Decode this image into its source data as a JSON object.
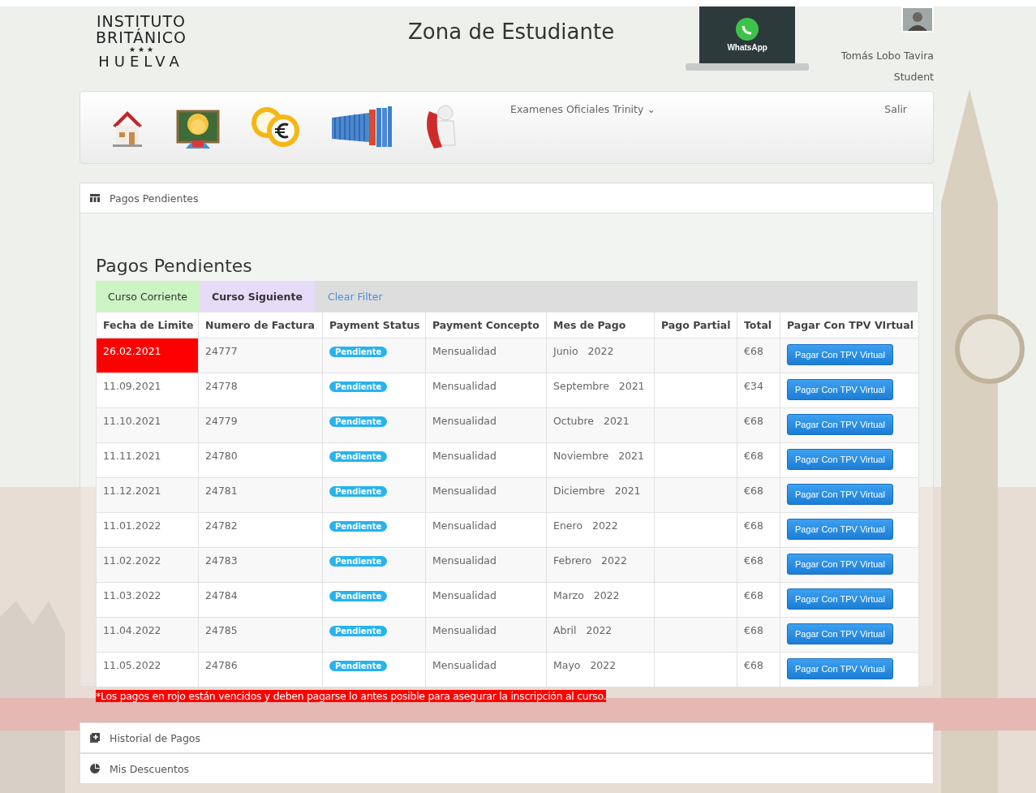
{
  "header": {
    "logo": {
      "line1": "INSTITUTO",
      "line2": "BRITÁNICO",
      "stars": "★ ★ ★",
      "line3": "HUELVA"
    },
    "title": "Zona de Estudiante",
    "promo_label": "WhatsApp",
    "user": {
      "name": "Tomás Lobo Tavira",
      "role": "Student"
    }
  },
  "nav": {
    "menu": "Examenes Oficiales Trinity",
    "menu_caret": "⌄",
    "logout": "Salir"
  },
  "panel": {
    "heading": "Pagos Pendientes",
    "title": "Pagos Pendientes",
    "tabs": [
      {
        "label": "Curso Corriente",
        "kind": "filter",
        "color": "#ccf5c4",
        "selected": false
      },
      {
        "label": "Curso Siguiente",
        "kind": "filter",
        "color": "#e6dcf7",
        "selected": true
      },
      {
        "label": "Clear Filter",
        "kind": "link",
        "selected": false
      }
    ],
    "table": {
      "columns": [
        "Fecha de Limite",
        "Numero de Factura",
        "Payment Status",
        "Payment Concepto",
        "Mes de Pago",
        "Pago Partial",
        "Total",
        "Pagar Con TPV VIrtual"
      ],
      "rows": [
        {
          "date": "26.02.2021",
          "overdue": true,
          "invoice": "24777",
          "status": "Pendiente",
          "concept": "Mensualidad",
          "month": "Junio   2022",
          "total": "€68",
          "action": "Pagar Con TPV Virtual"
        },
        {
          "date": "11.09.2021",
          "overdue": false,
          "invoice": "24778",
          "status": "Pendiente",
          "concept": "Mensualidad",
          "month": "Septembre   2021",
          "total": "€34",
          "action": "Pagar Con TPV Virtual"
        },
        {
          "date": "11.10.2021",
          "overdue": false,
          "invoice": "24779",
          "status": "Pendiente",
          "concept": "Mensualidad",
          "month": "Octubre   2021",
          "total": "€68",
          "action": "Pagar Con TPV Virtual"
        },
        {
          "date": "11.11.2021",
          "overdue": false,
          "invoice": "24780",
          "status": "Pendiente",
          "concept": "Mensualidad",
          "month": "Noviembre   2021",
          "total": "€68",
          "action": "Pagar Con TPV Virtual"
        },
        {
          "date": "11.12.2021",
          "overdue": false,
          "invoice": "24781",
          "status": "Pendiente",
          "concept": "Mensualidad",
          "month": "Diciembre   2021",
          "total": "€68",
          "action": "Pagar Con TPV Virtual"
        },
        {
          "date": "11.01.2022",
          "overdue": false,
          "invoice": "24782",
          "status": "Pendiente",
          "concept": "Mensualidad",
          "month": "Enero   2022",
          "total": "€68",
          "action": "Pagar Con TPV Virtual"
        },
        {
          "date": "11.02.2022",
          "overdue": false,
          "invoice": "24783",
          "status": "Pendiente",
          "concept": "Mensualidad",
          "month": "Febrero   2022",
          "total": "€68",
          "action": "Pagar Con TPV Virtual"
        },
        {
          "date": "11.03.2022",
          "overdue": false,
          "invoice": "24784",
          "status": "Pendiente",
          "concept": "Mensualidad",
          "month": "Marzo   2022",
          "total": "€68",
          "action": "Pagar Con TPV Virtual"
        },
        {
          "date": "11.04.2022",
          "overdue": false,
          "invoice": "24785",
          "status": "Pendiente",
          "concept": "Mensualidad",
          "month": "Abril   2022",
          "total": "€68",
          "action": "Pagar Con TPV Virtual"
        },
        {
          "date": "11.05.2022",
          "overdue": false,
          "invoice": "24786",
          "status": "Pendiente",
          "concept": "Mensualidad",
          "month": "Mayo   2022",
          "total": "€68",
          "action": "Pagar Con TPV Virtual"
        }
      ]
    },
    "note": "*Los pagos en rojo están vencidos y deben pagarse lo antes posible para asegurar la inscripción al curso."
  },
  "sections": [
    {
      "label": "Historial de Pagos"
    },
    {
      "label": "Mis Descuentos"
    }
  ]
}
